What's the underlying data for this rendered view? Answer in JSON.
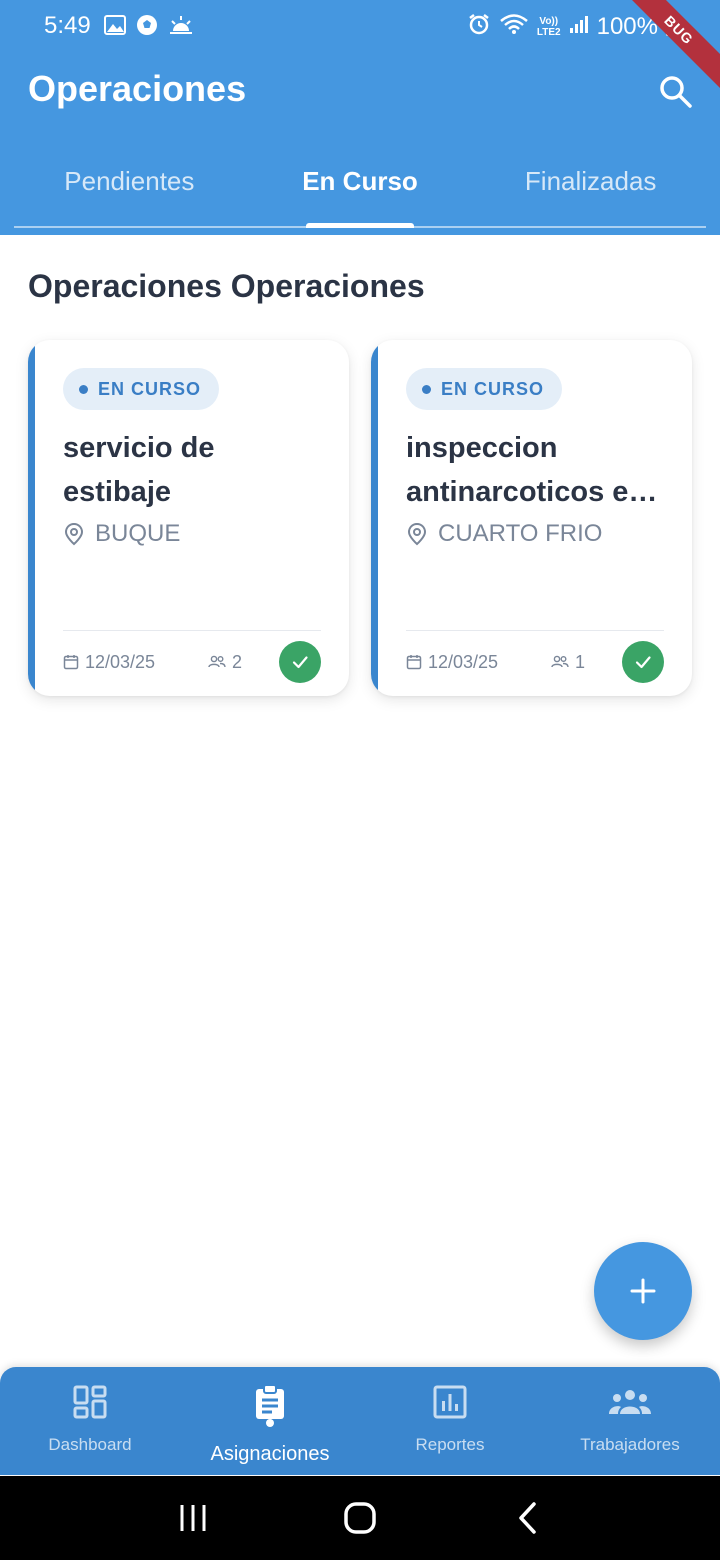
{
  "status_bar": {
    "time": "5:49",
    "battery": "100%",
    "lte_label_top": "Vo))",
    "lte_label_bottom": "LTE2"
  },
  "debug_banner": "BUG",
  "header": {
    "title": "Operaciones",
    "search_icon": "search-icon"
  },
  "tabs": [
    {
      "label": "Pendientes",
      "active": false
    },
    {
      "label": "En Curso",
      "active": true
    },
    {
      "label": "Finalizadas",
      "active": false
    }
  ],
  "section_title": "Operaciones Operaciones",
  "cards": [
    {
      "status": "EN CURSO",
      "title": "servicio de estibaje",
      "location": "BUQUE",
      "date": "12/03/25",
      "workers": "2"
    },
    {
      "status": "EN CURSO",
      "title": "inspeccion antinarcoticos en contenedor",
      "location": "CUARTO FRIO",
      "date": "12/03/25",
      "workers": "1"
    }
  ],
  "fab_icon": "plus-icon",
  "bottom_nav": [
    {
      "label": "Dashboard",
      "icon": "dashboard-icon",
      "active": false
    },
    {
      "label": "Asignaciones",
      "icon": "clipboard-icon",
      "active": true
    },
    {
      "label": "Reportes",
      "icon": "bar-chart-icon",
      "active": false
    },
    {
      "label": "Trabajadores",
      "icon": "group-icon",
      "active": false
    }
  ],
  "colors": {
    "primary": "#4597E0",
    "nav_bg": "#3A86CE",
    "accent_bar": "#3A86CE",
    "badge_bg": "#E4EEF8",
    "badge_text": "#3A7EC5",
    "success": "#3AA466",
    "title_text": "#2B3445",
    "muted_text": "#7A8698"
  }
}
